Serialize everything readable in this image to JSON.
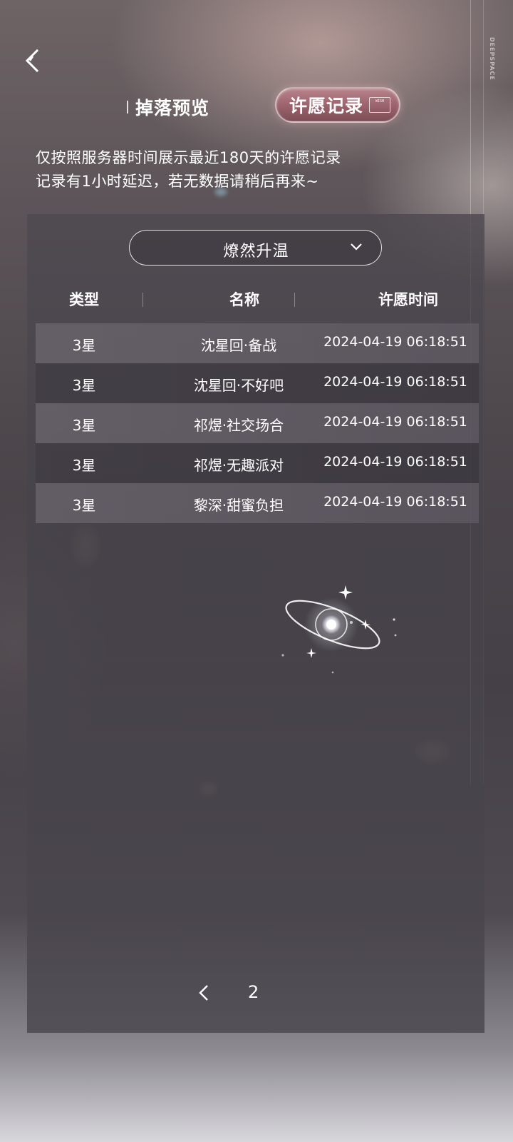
{
  "header": {
    "back_label": "",
    "brand": "DEEPSPACE"
  },
  "tabs": [
    {
      "label": "掉落预览",
      "active": false
    },
    {
      "label": "许愿记录",
      "active": true,
      "tag": "WISH"
    }
  ],
  "notice": {
    "line1": "仅按照服务器时间展示最近180天的许愿记录",
    "line2": "记录有1小时延迟，若无数据请稍后再来~"
  },
  "pool_select": {
    "value": "燎然升温"
  },
  "table": {
    "columns": [
      "类型",
      "名称",
      "许愿时间"
    ],
    "rows": [
      {
        "type": "3星",
        "name": "沈星回·备战",
        "time": "2024-04-19 06:18:51"
      },
      {
        "type": "3星",
        "name": "沈星回·不好吧",
        "time": "2024-04-19 06:18:51"
      },
      {
        "type": "3星",
        "name": "祁煜·社交场合",
        "time": "2024-04-19 06:18:51"
      },
      {
        "type": "3星",
        "name": "祁煜·无趣派对",
        "time": "2024-04-19 06:18:51"
      },
      {
        "type": "3星",
        "name": "黎深·甜蜜负担",
        "time": "2024-04-19 06:18:51"
      }
    ]
  },
  "pager": {
    "current_page": "2"
  },
  "icons": {
    "back": "back-arrow-icon",
    "dropdown": "chevron-down-icon",
    "prev": "chevron-left-icon",
    "emblem": "planet-sparkle-icon"
  },
  "colors": {
    "active_tab": "#9a626b",
    "panel": "#4a464e",
    "text": "#ffffff"
  }
}
